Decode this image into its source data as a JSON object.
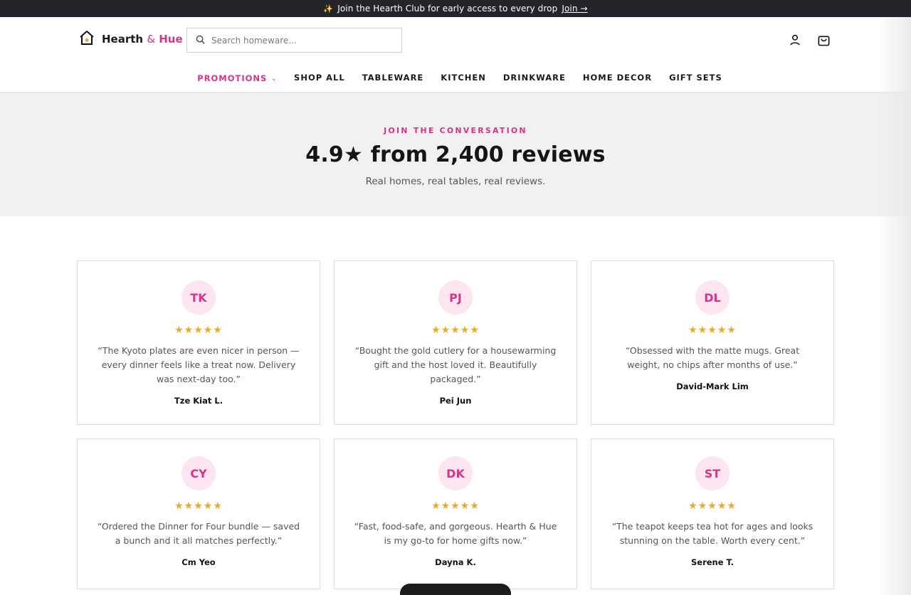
{
  "announcement": {
    "icon": "sparkle-icon",
    "text": "Join the Hearth Club for early access to every drop",
    "link": "Join →"
  },
  "brand": {
    "name_part1": "Hearth ",
    "ampersand": "&",
    "name_part2": " Hue",
    "logo_icon": "house-icon",
    "accent_color": "#d6338a"
  },
  "search": {
    "placeholder": "Search homeware...",
    "value": ""
  },
  "header_icons": [
    "account-icon",
    "cart-icon"
  ],
  "nav": [
    {
      "label": "PROMOTIONS",
      "active": true
    },
    {
      "label": "SHOP ALL"
    },
    {
      "label": "TABLEWARE"
    },
    {
      "label": "KITCHEN"
    },
    {
      "label": "DRINKWARE"
    },
    {
      "label": "HOME DECOR"
    },
    {
      "label": "GIFT SETS"
    }
  ],
  "hero": {
    "eyebrow": "JOIN THE CONVERSATION",
    "title": "4.9★ from 2,400 reviews",
    "subtitle": "Real homes, real tables, real reviews."
  },
  "reviews": [
    {
      "initials": "TK",
      "stars": "★★★★★",
      "rating": 5,
      "quote": "“The Kyoto plates are even nicer in person — every dinner feels like a treat now. Delivery was next-day too.”",
      "name": "Tze Kiat L."
    },
    {
      "initials": "PJ",
      "stars": "★★★★★",
      "rating": 5,
      "quote": "“Bought the gold cutlery for a housewarming gift and the host loved it. Beautifully packaged.”",
      "name": "Pei Jun"
    },
    {
      "initials": "DL",
      "stars": "★★★★★",
      "rating": 5,
      "quote": "“Obsessed with the matte mugs. Great weight, no chips after months of use.”",
      "name": "David-Mark Lim"
    },
    {
      "initials": "CY",
      "stars": "★★★★★",
      "rating": 5,
      "quote": "“Ordered the Dinner for Four bundle — saved a bunch and it all matches perfectly.”",
      "name": "Cm Yeo"
    },
    {
      "initials": "DK",
      "stars": "★★★★★",
      "rating": 5,
      "quote": "“Fast, food-safe, and gorgeous. Hearth & Hue is my go-to for home gifts now.”",
      "name": "Dayna K."
    },
    {
      "initials": "ST",
      "stars": "★★★★★",
      "rating": 5,
      "quote": "“The teapot keeps tea hot for ages and looks stunning on the table. Worth every cent.”",
      "name": "Serene T."
    }
  ],
  "colors": {
    "announce_bg": "#26232b",
    "hero_bg": "#f2f1ef",
    "star": "#eda72b",
    "avatar_bg": "#fce4f0"
  }
}
